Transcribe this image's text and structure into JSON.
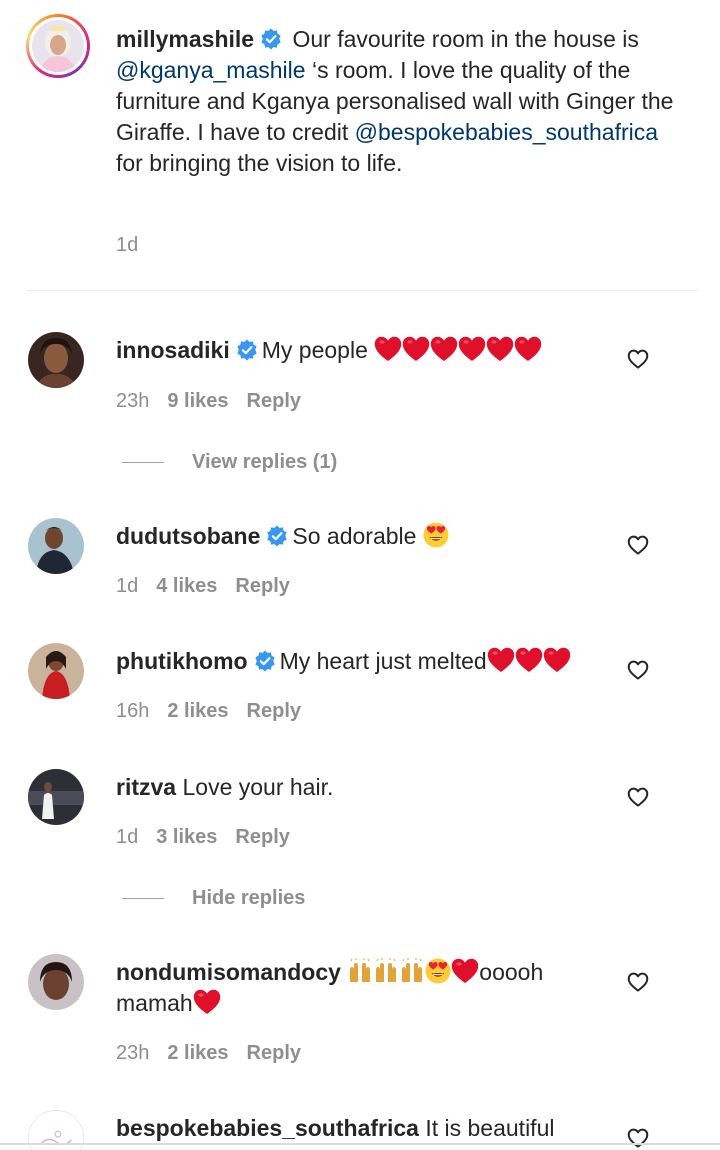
{
  "caption": {
    "username": "millymashile",
    "text_1": " Our favourite room in the house is ",
    "mention_1": "@kganya_mashile",
    "text_2": " ‘s room. I love the quality of the furniture and Kganya personalised wall with Ginger the Giraffe. I have to credit ",
    "mention_2": "@bespokebabies_southafrica",
    "text_3": " for bringing the vision to life.",
    "time": "1d"
  },
  "labels": {
    "reply": "Reply",
    "view_replies": "View replies (1)",
    "hide_replies": "Hide replies"
  },
  "comments": [
    {
      "username": "innosadiki",
      "verified": true,
      "text": "My people",
      "time": "23h",
      "likes": "9 likes"
    },
    {
      "username": "dudutsobane",
      "verified": true,
      "text": "So adorable",
      "time": "1d",
      "likes": "4 likes"
    },
    {
      "username": "phutikhomo",
      "verified": true,
      "text": "My heart just melted",
      "time": "16h",
      "likes": "2 likes"
    },
    {
      "username": "ritzva",
      "verified": false,
      "text": "Love your hair.",
      "time": "1d",
      "likes": "3 likes"
    },
    {
      "username": "nondumisomandocy",
      "verified": false,
      "text_a": "ooooh mamah",
      "time": "23h",
      "likes": "2 likes"
    },
    {
      "username": "bespokebabies_southafrica",
      "verified": false,
      "text": "It is beautiful"
    }
  ],
  "icons": {
    "verified": "verified-badge-icon",
    "like": "heart-outline-icon",
    "red_heart": "red-heart-emoji",
    "heart_eyes": "heart-eyes-emoji",
    "raised_hands": "raised-hands-emoji"
  },
  "colors": {
    "text": "#262626",
    "muted": "#8e8e8e",
    "mention": "#00376b",
    "verified": "#3897f0",
    "heart": "#e0102a"
  }
}
